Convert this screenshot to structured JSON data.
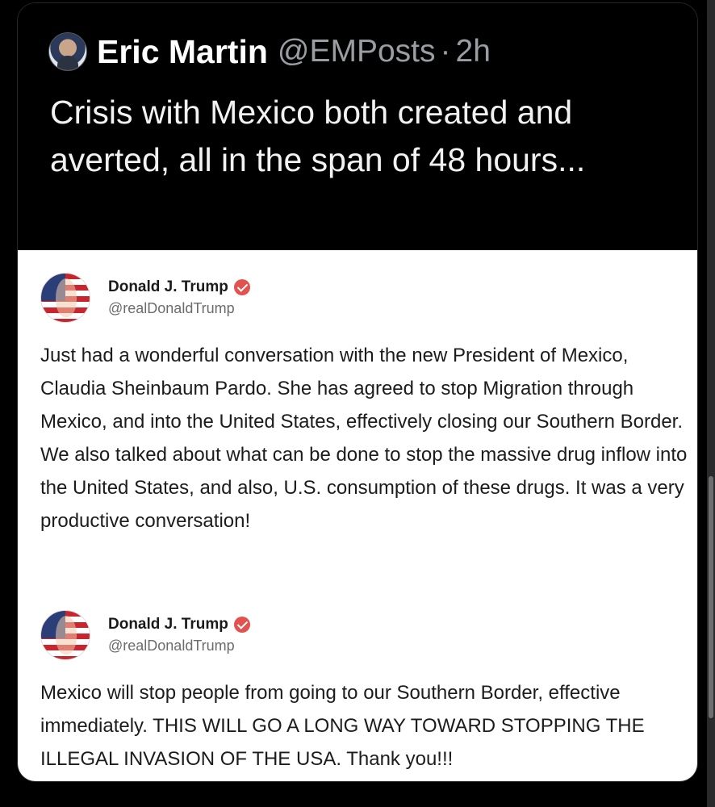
{
  "tweet": {
    "author_name": "Eric Martin",
    "author_handle": "@EMPosts",
    "separator": "·",
    "time": "2h",
    "text": "Crisis with Mexico both created and averted, all in the span of 48 hours..."
  },
  "embedded_posts": [
    {
      "name": "Donald J. Trump",
      "handle": "@realDonaldTrump",
      "verified": true,
      "text": "Just had a wonderful conversation with the new President of Mexico, Claudia Sheinbaum Pardo. She has agreed to stop Migration through Mexico, and into the United States, effectively closing our Southern Border. We also talked about what can be done to stop the massive drug inflow into the United States, and also, U.S. consumption of these drugs. It was a very productive conversation!"
    },
    {
      "name": "Donald J. Trump",
      "handle": "@realDonaldTrump",
      "verified": true,
      "text": "Mexico will stop people from going to our Southern Border, effective immediately. THIS WILL GO A LONG WAY TOWARD STOPPING THE ILLEGAL INVASION OF THE USA. Thank you!!!"
    }
  ],
  "colors": {
    "background": "#000000",
    "text_primary": "#f2f2f2",
    "text_secondary": "#9a9ea3",
    "verified_badge": "#e2524f"
  },
  "icons": {
    "verified": "verified-check-icon"
  }
}
